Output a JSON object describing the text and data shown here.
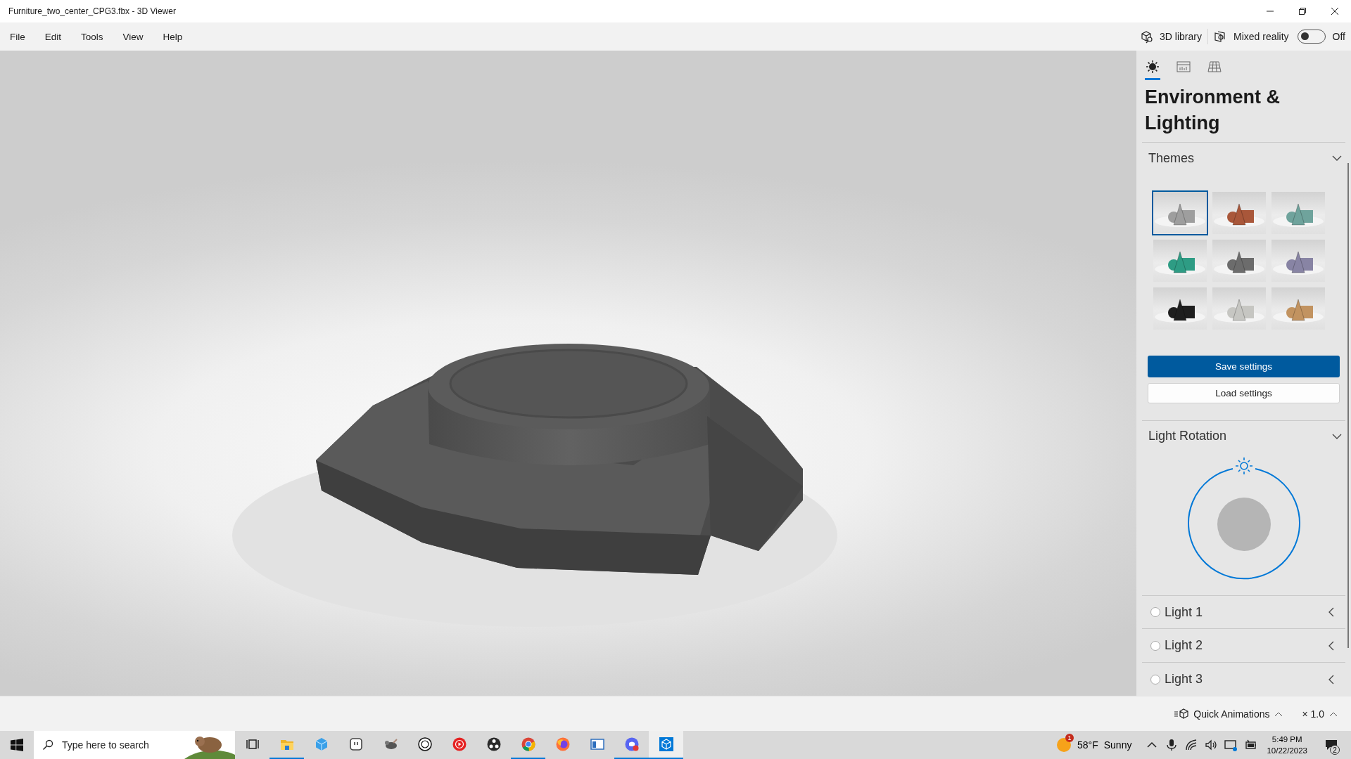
{
  "window": {
    "title": "Furniture_two_center_CPG3.fbx - 3D Viewer"
  },
  "menu": [
    "File",
    "Edit",
    "Tools",
    "View",
    "Help"
  ],
  "toolbar": {
    "library": "3D library",
    "mixed_reality": {
      "label": "Mixed reality",
      "on": false,
      "state_text": "Off"
    }
  },
  "panel": {
    "tabs": [
      {
        "kind": "environment",
        "selected": true
      },
      {
        "kind": "stats",
        "selected": false
      },
      {
        "kind": "grid",
        "selected": false
      }
    ],
    "title": "Environment & Lighting",
    "themes": {
      "heading": "Themes",
      "expanded": true,
      "items": [
        {
          "color": "#9e9e9e",
          "selected": true
        },
        {
          "color": "#a9573a",
          "selected": false
        },
        {
          "color": "#6fa39c",
          "selected": false
        },
        {
          "color": "#2e9c84",
          "selected": false
        },
        {
          "color": "#6c6c6c",
          "selected": false
        },
        {
          "color": "#8884a4",
          "selected": false
        },
        {
          "color": "#1e1e1e",
          "selected": false
        },
        {
          "color": "#c6c6c2",
          "selected": false
        },
        {
          "color": "#c29360",
          "selected": false
        }
      ],
      "save": "Save settings",
      "load": "Load settings"
    },
    "light_rotation": {
      "heading": "Light Rotation",
      "expanded": true
    },
    "lights": [
      {
        "label": "Light 1",
        "on": false
      },
      {
        "label": "Light 2",
        "on": false
      },
      {
        "label": "Light 3",
        "on": false
      }
    ]
  },
  "status_bar": {
    "animations": "Quick Animations",
    "speed": "× 1.0"
  },
  "taskbar": {
    "search_placeholder": "Type here to search",
    "apps": [
      {
        "kind": "taskview",
        "running": false,
        "selected": false
      },
      {
        "kind": "folder",
        "running": true,
        "selected": false
      },
      {
        "kind": "cube-blue",
        "running": false,
        "selected": false
      },
      {
        "kind": "square-face",
        "running": false,
        "selected": false
      },
      {
        "kind": "animal",
        "running": false,
        "selected": false
      },
      {
        "kind": "ring",
        "running": false,
        "selected": false
      },
      {
        "kind": "play-red",
        "running": false,
        "selected": false
      },
      {
        "kind": "aperture",
        "running": false,
        "selected": false
      },
      {
        "kind": "browser-round",
        "running": true,
        "selected": false
      },
      {
        "kind": "browser-fox",
        "running": false,
        "selected": false
      },
      {
        "kind": "window",
        "running": false,
        "selected": false
      },
      {
        "kind": "chat",
        "running": true,
        "selected": false
      },
      {
        "kind": "cube-outline",
        "running": true,
        "selected": true
      }
    ],
    "weather": {
      "badge": "1",
      "temperature": "58°F",
      "condition": "Sunny"
    },
    "time": "5:49 PM",
    "date": "10/22/2023",
    "notifications": "2"
  }
}
